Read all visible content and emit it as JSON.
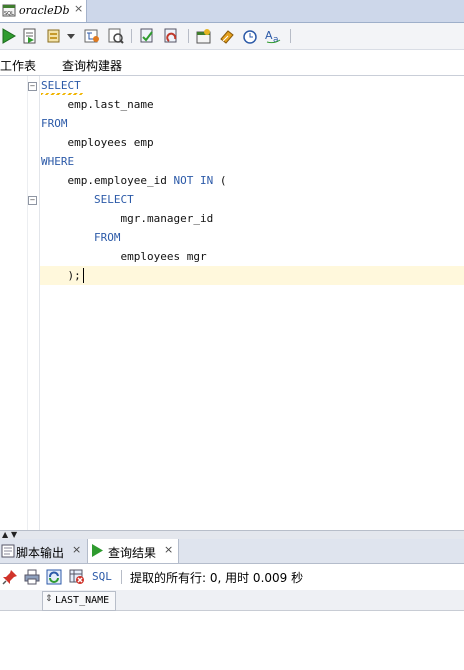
{
  "document_tab": {
    "title": "oracleDb",
    "close": "×"
  },
  "toolbar": {
    "icons": [
      "run-statement-icon",
      "run-script-icon",
      "commit-icon",
      "dropdown-arrow-icon",
      "explain-plan-icon",
      "autotrace-icon",
      "rollback-icon",
      "clear-icon",
      "sql-tuning-icon",
      "eraser-icon",
      "history-icon",
      "format-icon"
    ]
  },
  "subtabs": {
    "worksheet": "工作表",
    "query_builder": "查询构建器"
  },
  "editor": {
    "lines": [
      {
        "indent": "",
        "kw": "SELECT",
        "text": ""
      },
      {
        "indent": "    ",
        "kw": "",
        "text": "emp.last_name"
      },
      {
        "indent": "",
        "kw": "FROM",
        "text": ""
      },
      {
        "indent": "    ",
        "kw": "",
        "text": "employees emp"
      },
      {
        "indent": "",
        "kw": "WHERE",
        "text": ""
      },
      {
        "indent": "    ",
        "kw": "",
        "text": "emp.employee_id ",
        "kw2": "NOT IN",
        "tail": " ("
      },
      {
        "indent": "        ",
        "kw": "SELECT",
        "text": ""
      },
      {
        "indent": "            ",
        "kw": "",
        "text": "mgr.manager_id"
      },
      {
        "indent": "        ",
        "kw": "FROM",
        "text": ""
      },
      {
        "indent": "            ",
        "kw": "",
        "text": "employees mgr"
      },
      {
        "indent": "    ",
        "kw": "",
        "text": ");"
      }
    ]
  },
  "bottom_tabs": {
    "script_output": "脚本输出",
    "query_result": "查询结果",
    "close": "×"
  },
  "results_toolbar": {
    "sql_label": "SQL",
    "status_text": "提取的所有行: 0, 用时 0.009 秒"
  },
  "grid": {
    "columns": [
      "LAST_NAME"
    ],
    "sort_glyph": "⇕"
  },
  "colors": {
    "keyword": "#2c5aa8",
    "current_line": "#fff8dc",
    "tabstrip": "#cdd7ea"
  }
}
